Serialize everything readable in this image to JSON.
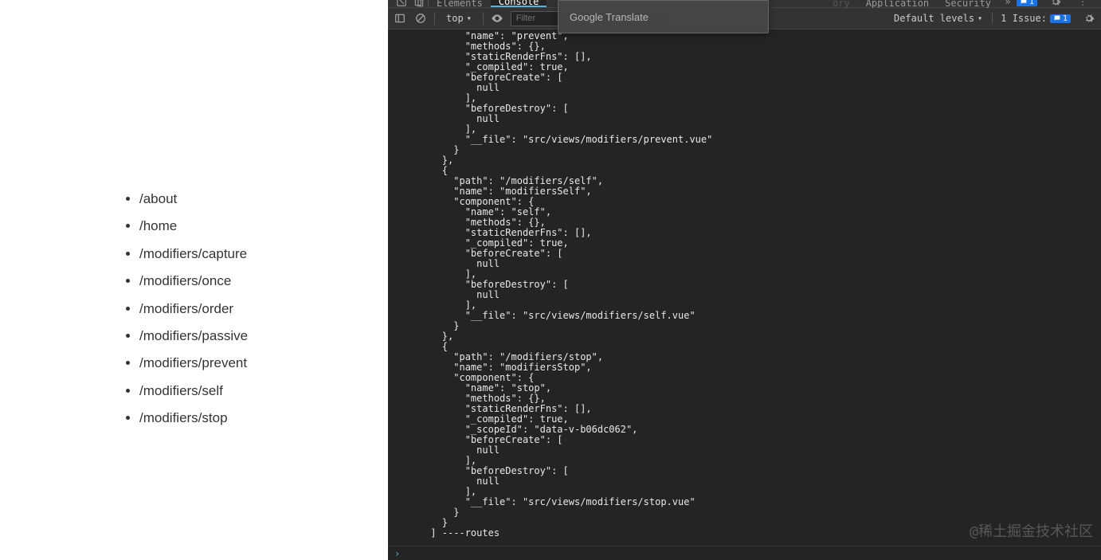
{
  "routes": [
    {
      "path": "/about"
    },
    {
      "path": "/home"
    },
    {
      "path": "/modifiers/capture"
    },
    {
      "path": "/modifiers/once"
    },
    {
      "path": "/modifiers/order"
    },
    {
      "path": "/modifiers/passive"
    },
    {
      "path": "/modifiers/prevent"
    },
    {
      "path": "/modifiers/self"
    },
    {
      "path": "/modifiers/stop"
    }
  ],
  "devtools": {
    "tabs": {
      "elements": "Elements",
      "console": "Console",
      "application": "Application",
      "security": "Security"
    },
    "toolbar": {
      "context": "top",
      "filter_placeholder": "Filter",
      "levels": "Default levels",
      "issues_label": "1 Issue:",
      "issues_badge": "1",
      "msg_badge": "1"
    },
    "translate_popup": "Google Translate",
    "watermark": "@稀土掘金技术社区",
    "console_output": "            \"name\": \"prevent\",\n            \"methods\": {},\n            \"staticRenderFns\": [],\n            \"_compiled\": true,\n            \"beforeCreate\": [\n              null\n            ],\n            \"beforeDestroy\": [\n              null\n            ],\n            \"__file\": \"src/views/modifiers/prevent.vue\"\n          }\n        },\n        {\n          \"path\": \"/modifiers/self\",\n          \"name\": \"modifiersSelf\",\n          \"component\": {\n            \"name\": \"self\",\n            \"methods\": {},\n            \"staticRenderFns\": [],\n            \"_compiled\": true,\n            \"beforeCreate\": [\n              null\n            ],\n            \"beforeDestroy\": [\n              null\n            ],\n            \"__file\": \"src/views/modifiers/self.vue\"\n          }\n        },\n        {\n          \"path\": \"/modifiers/stop\",\n          \"name\": \"modifiersStop\",\n          \"component\": {\n            \"name\": \"stop\",\n            \"methods\": {},\n            \"staticRenderFns\": [],\n            \"_compiled\": true,\n            \"_scopeId\": \"data-v-b06dc062\",\n            \"beforeCreate\": [\n              null\n            ],\n            \"beforeDestroy\": [\n              null\n            ],\n            \"__file\": \"src/views/modifiers/stop.vue\"\n          }\n        }\n      ] ----routes"
  }
}
